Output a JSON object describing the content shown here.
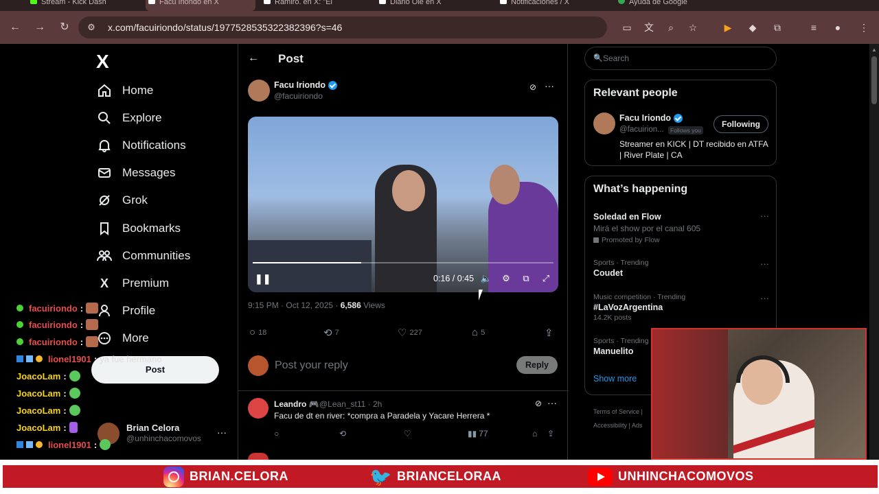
{
  "browser": {
    "tabs": [
      {
        "label": "Stream - Kick Dash"
      },
      {
        "label": "Facu Iriondo en X"
      },
      {
        "label": "Ramiro. en X: \"El"
      },
      {
        "label": "Diario Olé en X"
      },
      {
        "label": "Notificaciones / X"
      },
      {
        "label": "Ayuda de Google"
      }
    ],
    "url": "x.com/facuiriondo/status/1977528535322382396?s=46"
  },
  "nav": {
    "logo": "X",
    "items": [
      {
        "label": "Home"
      },
      {
        "label": "Explore"
      },
      {
        "label": "Notifications"
      },
      {
        "label": "Messages"
      },
      {
        "label": "Grok"
      },
      {
        "label": "Bookmarks"
      },
      {
        "label": "Communities"
      },
      {
        "label": "Premium"
      },
      {
        "label": "Profile"
      },
      {
        "label": "More"
      }
    ],
    "post_button": "Post",
    "account": {
      "name": "Brian Celora",
      "handle": "@unhinchacomovos"
    }
  },
  "chat": [
    {
      "user": "facuiriondo",
      "msg": "",
      "color": "#e84d4d"
    },
    {
      "user": "facuiriondo",
      "msg": "",
      "color": "#e84d4d"
    },
    {
      "user": "facuiriondo",
      "msg": "",
      "color": "#e84d4d"
    },
    {
      "user": "lionel1901",
      "msg": "ya fue hermano",
      "color": "#e84d4d"
    },
    {
      "user": "JoacoLam",
      "msg": "",
      "color": "#f7d51d"
    },
    {
      "user": "JoacoLam",
      "msg": "",
      "color": "#f7d51d"
    },
    {
      "user": "JoacoLam",
      "msg": "",
      "color": "#f7d51d"
    },
    {
      "user": "JoacoLam",
      "msg": "",
      "color": "#f7d51d"
    },
    {
      "user": "lionel1901",
      "msg": "",
      "color": "#e84d4d"
    }
  ],
  "post": {
    "header": "Post",
    "author_name": "Facu Iriondo",
    "author_handle": "@facuiriondo",
    "video_time": "0:16 / 0:45",
    "video_progress": 0.36,
    "timestamp": "9:15 PM · Oct 12, 2025 · ",
    "views_count": "6,586",
    "views_label": " Views",
    "replies": "18",
    "reposts": "7",
    "likes": "227",
    "bookmarks": "5",
    "reply_placeholder": "Post your reply",
    "reply_button": "Reply"
  },
  "replies": [
    {
      "name": "Leandro 🎮",
      "handle": "@Lean_st11 · 2h",
      "text": "Facu de dt en river: *compra a Paradela y Yacare Herrera *",
      "views": "77"
    }
  ],
  "sidebar": {
    "search_placeholder": "Search",
    "relevant_title": "Relevant people",
    "relevant": {
      "name": "Facu Iriondo",
      "handle": "@facuirion...",
      "follows_you": "Follows you",
      "button": "Following",
      "bio": "Streamer en KICK | DT recibido en ATFA | River Plate | CA"
    },
    "happening_title": "What’s happening",
    "trends": [
      {
        "kind": "",
        "title": "Soledad en Flow",
        "sub": "Mirá el show por el canal 605",
        "promo": "Promoted by Flow"
      },
      {
        "kind": "Sports · Trending",
        "title": "Coudet",
        "sub": "",
        "promo": ""
      },
      {
        "kind": "Music competition · Trending",
        "title": "#LaVozArgentina",
        "sub": "14.2K posts",
        "promo": ""
      },
      {
        "kind": "Sports · Trending",
        "title": "Manuelito",
        "sub": "",
        "promo": ""
      }
    ],
    "show_more": "Show more",
    "footer1": "Terms of Service |",
    "footer2": "Accessibility | Ads"
  },
  "banner": {
    "instagram": "BRIAN.CELORA",
    "twitter": "BRIANCELORAA",
    "youtube": "UNHINCHACOMOVOS"
  },
  "colors": {
    "accent": "#1d9bf0",
    "banner": "#c21a24",
    "browser_chrome": "#5a3a3a"
  }
}
